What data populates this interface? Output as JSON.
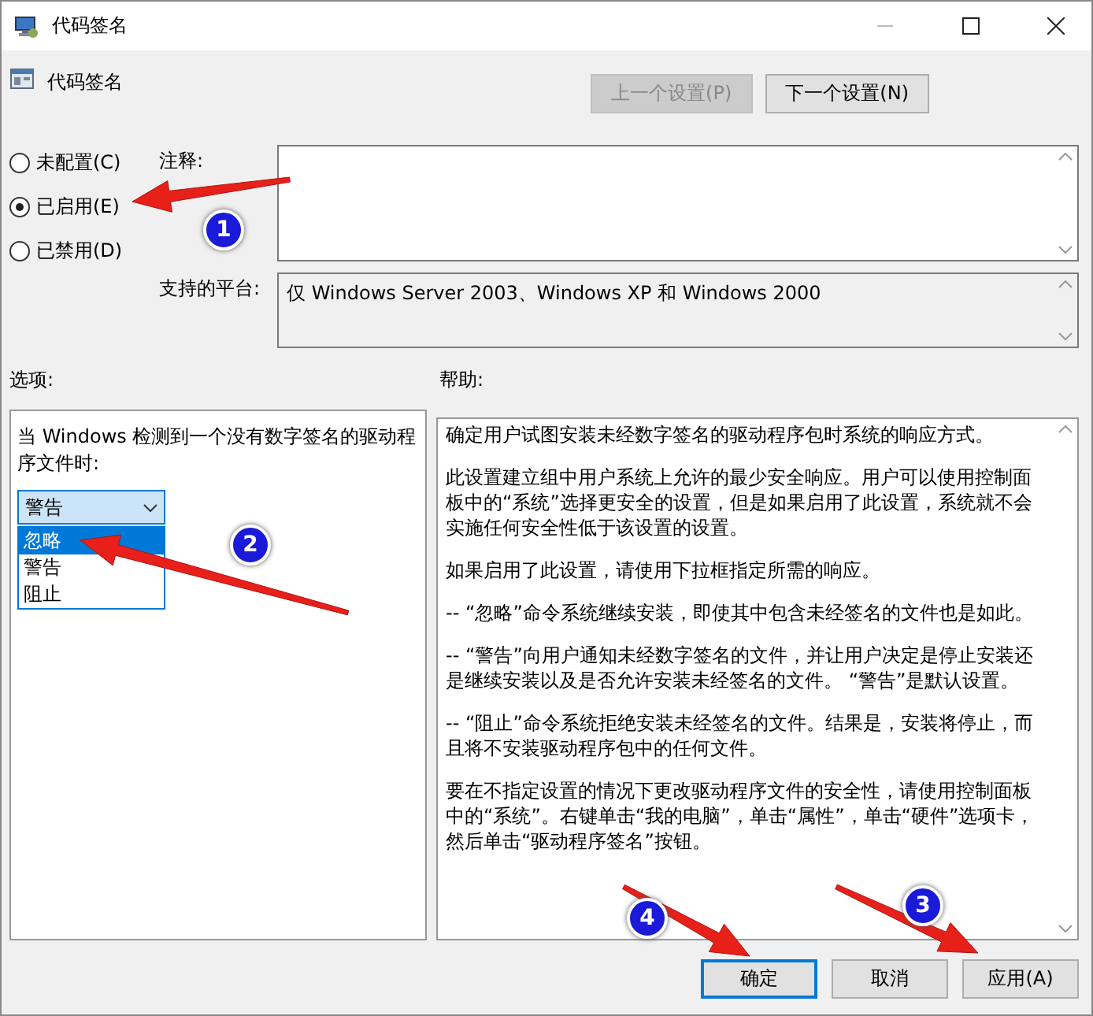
{
  "window": {
    "title": "代码签名"
  },
  "policy": {
    "title": "代码签名"
  },
  "nav_buttons": [
    {
      "label": "上一个设置(P)",
      "disabled": true
    },
    {
      "label": "下一个设置(N)",
      "disabled": false
    }
  ],
  "states": [
    {
      "label": "未配置(C)",
      "selected": false
    },
    {
      "label": "已启用(E)",
      "selected": true
    },
    {
      "label": "已禁用(D)",
      "selected": false
    }
  ],
  "comment": {
    "label": "注释:"
  },
  "platform": {
    "label": "支持的平台:",
    "value": "仅 Windows Server 2003、Windows XP 和 Windows 2000"
  },
  "options": {
    "label": "选项:",
    "prompt": "当 Windows 检测到一个没有数字签名的驱动程序文件时:",
    "dropdown": {
      "value": "警告",
      "items": [
        {
          "label": "忽略",
          "highlighted": true
        },
        {
          "label": "警告",
          "highlighted": false
        },
        {
          "label": "阻止",
          "highlighted": false
        }
      ]
    }
  },
  "help": {
    "label": "帮助:",
    "paragraphs": [
      "确定用户试图安装未经数字签名的驱动程序包时系统的响应方式。",
      "此设置建立组中用户系统上允许的最少安全响应。用户可以使用控制面板中的“系统”选择更安全的设置，但是如果启用了此设置，系统就不会实施任何安全性低于该设置的设置。",
      "如果启用了此设置，请使用下拉框指定所需的响应。",
      "-- “忽略”命令系统继续安装，即使其中包含未经签名的文件也是如此。",
      "-- “警告”向用户通知未经数字签名的文件，并让用户决定是停止安装还是继续安装以及是否允许安装未经签名的文件。 “警告”是默认设置。",
      "-- “阻止”命令系统拒绝安装未经签名的文件。结果是，安装将停止，而且将不安装驱动程序包中的任何文件。",
      "要在不指定设置的情况下更改驱动程序文件的安全性，请使用控制面板中的“系统”。右键单击“我的电脑”，单击“属性”，单击“硬件”选项卡，然后单击“驱动程序签名”按钮。"
    ]
  },
  "buttons": [
    {
      "label": "确定",
      "default": true
    },
    {
      "label": "取消",
      "default": false
    },
    {
      "label": "应用(A)",
      "default": false
    }
  ],
  "annotations": [
    {
      "number": "1"
    },
    {
      "number": "2"
    },
    {
      "number": "3"
    },
    {
      "number": "4"
    }
  ]
}
